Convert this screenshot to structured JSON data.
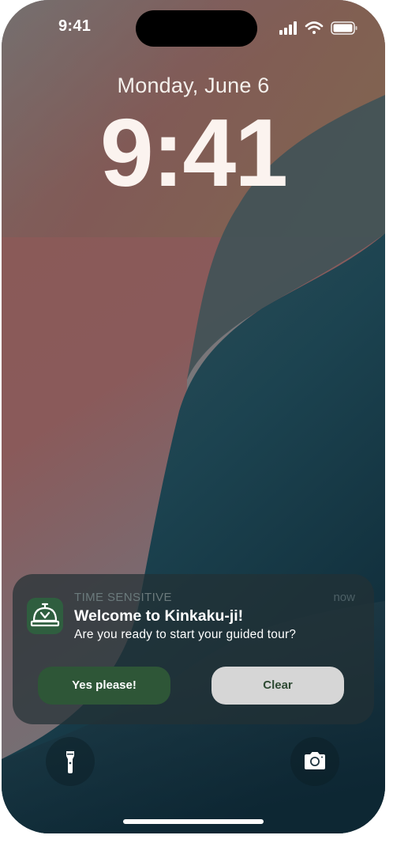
{
  "status_bar": {
    "time": "9:41",
    "icons": [
      "cellular-signal-icon",
      "wifi-icon",
      "battery-icon"
    ]
  },
  "lock_screen": {
    "date": "Monday, June 6",
    "time": "9:41"
  },
  "notification": {
    "app_icon": "service-bell-icon",
    "category": "TIME SENSITIVE",
    "timestamp": "now",
    "title": "Welcome to Kinkaku-ji!",
    "body": "Are you ready to start your guided tour?",
    "actions": {
      "primary_label": "Yes please!",
      "secondary_label": "Clear"
    }
  },
  "quick_actions": {
    "left_icon": "flashlight-icon",
    "right_icon": "camera-icon"
  },
  "colors": {
    "accent_green": "#2e5637",
    "clear_button": "#d6d6d6",
    "notification_bg": "#233034"
  }
}
